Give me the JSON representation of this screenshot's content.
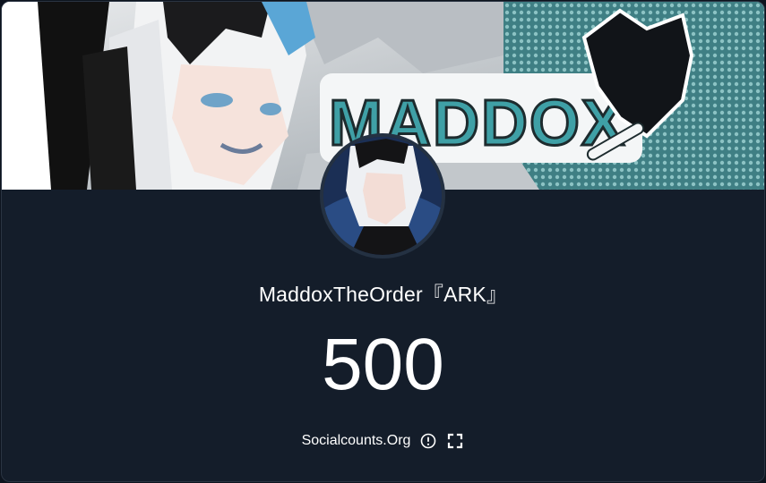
{
  "profile": {
    "name": "MaddoxTheOrder『ARK』",
    "count": "500"
  },
  "banner": {
    "logo_text": "MADDOX"
  },
  "footer": {
    "site_label": "Socialcounts.Org",
    "info_icon": "info-circle-icon",
    "fullscreen_icon": "fullscreen-icon"
  },
  "colors": {
    "background": "#141d2a",
    "text": "#ffffff",
    "logo_teal": "#3fa0a6"
  }
}
